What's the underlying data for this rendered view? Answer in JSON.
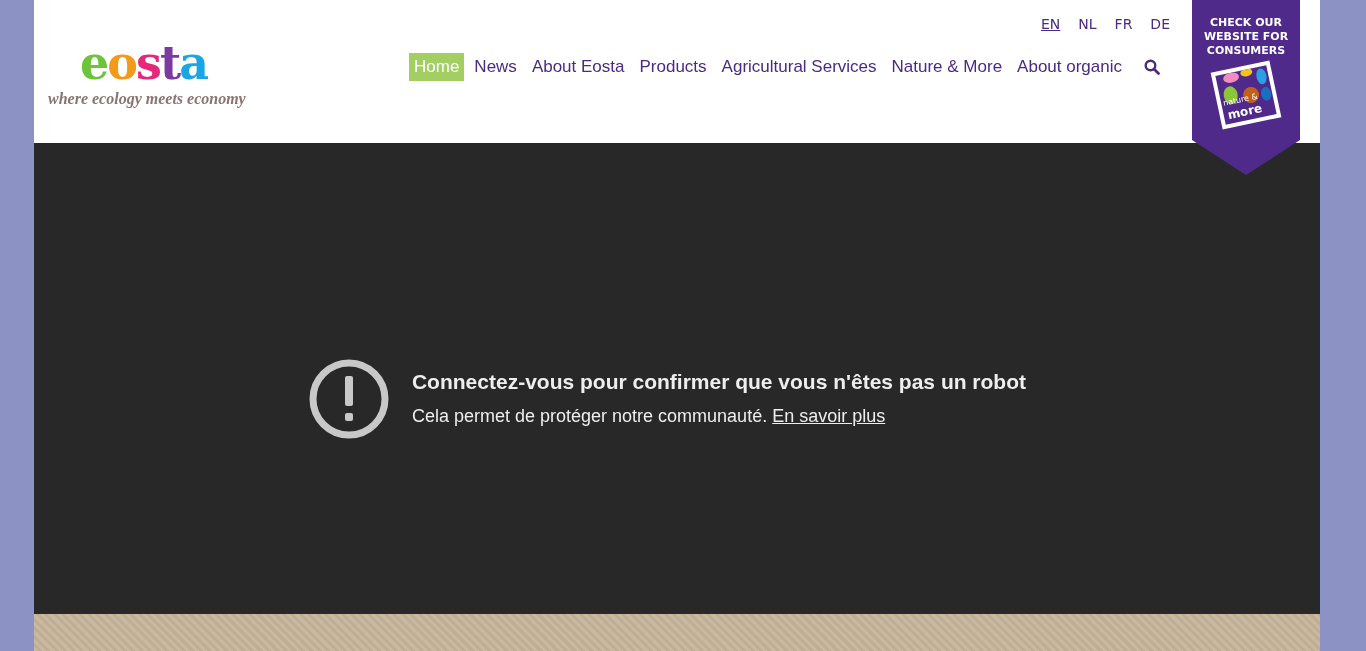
{
  "logo": {
    "wordmark": "eosta",
    "tagline": "where ecology meets economy"
  },
  "languages": [
    {
      "label": "EN",
      "selected": true
    },
    {
      "label": "NL",
      "selected": false
    },
    {
      "label": "FR",
      "selected": false
    },
    {
      "label": "DE",
      "selected": false
    }
  ],
  "nav": [
    {
      "label": "Home",
      "selected": true
    },
    {
      "label": "News",
      "selected": false
    },
    {
      "label": "About Eosta",
      "selected": false
    },
    {
      "label": "Products",
      "selected": false
    },
    {
      "label": "Agricultural Services",
      "selected": false
    },
    {
      "label": "Nature & More",
      "selected": false
    },
    {
      "label": "About organic",
      "selected": false
    }
  ],
  "consumer_badge": {
    "title": "CHECK OUR WEBSITE FOR CONSUMERS",
    "stamp_top": "nature &",
    "stamp_bottom": "more"
  },
  "video_error": {
    "title": "Connectez-vous pour confirmer que vous n'êtes pas un robot",
    "message": "Cela permet de protéger notre communauté.",
    "link": "En savoir plus"
  }
}
